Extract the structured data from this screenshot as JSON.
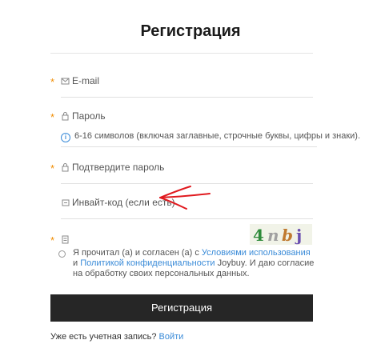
{
  "page": {
    "title": "Регистрация"
  },
  "form": {
    "email": {
      "label": "E-mail",
      "required_mark": "*"
    },
    "password": {
      "label": "Пароль",
      "required_mark": "*"
    },
    "password_hint": "6-16 символов (включая заглавные, строчные буквы, цифры и знаки).",
    "confirm": {
      "label": "Подтвердите пароль",
      "required_mark": "*"
    },
    "invite": {
      "label": "Инвайт-код (если есть)"
    },
    "captcha": {
      "required_mark": "*",
      "image_text": [
        "4",
        "n",
        "b",
        "j"
      ]
    }
  },
  "agreement": {
    "prefix": "Я прочитал (а) и согласен (а) с ",
    "terms_link": "Условиями использования",
    "middle": " и ",
    "privacy_link": "Политикой конфиденциальности",
    "suffix": " Joybuy. И даю согласие на обработку своих персональных данных."
  },
  "register_button": "Регистрация",
  "login": {
    "prompt": "Уже есть учетная запись? ",
    "link": "Войти"
  },
  "colors": {
    "accent": "#3a8bd8",
    "required": "#f08c00",
    "button": "#262626",
    "annotation": "#e0191e"
  }
}
